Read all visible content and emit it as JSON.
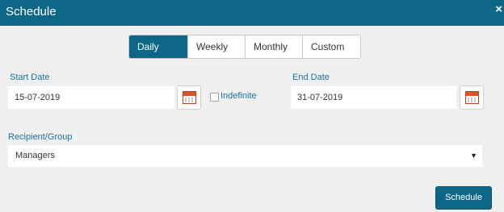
{
  "header": {
    "title": "Schedule",
    "close_label": "×"
  },
  "tabs": [
    {
      "label": "Daily",
      "active": true
    },
    {
      "label": "Weekly",
      "active": false
    },
    {
      "label": "Monthly",
      "active": false
    },
    {
      "label": "Custom",
      "active": false
    }
  ],
  "start_date": {
    "label": "Start Date",
    "value": "15-07-2019",
    "calendar_icon": "calendar-icon"
  },
  "indefinite": {
    "label": "Indefinite",
    "checked": false
  },
  "end_date": {
    "label": "End Date",
    "value": "31-07-2019",
    "calendar_icon": "calendar-icon"
  },
  "recipient": {
    "label": "Recipient/Group",
    "selected": "Managers",
    "arrow": "▼"
  },
  "actions": {
    "schedule_label": "Schedule"
  },
  "colors": {
    "primary": "#0d6888",
    "label": "#1a72a0",
    "background": "#f0f0f0"
  }
}
